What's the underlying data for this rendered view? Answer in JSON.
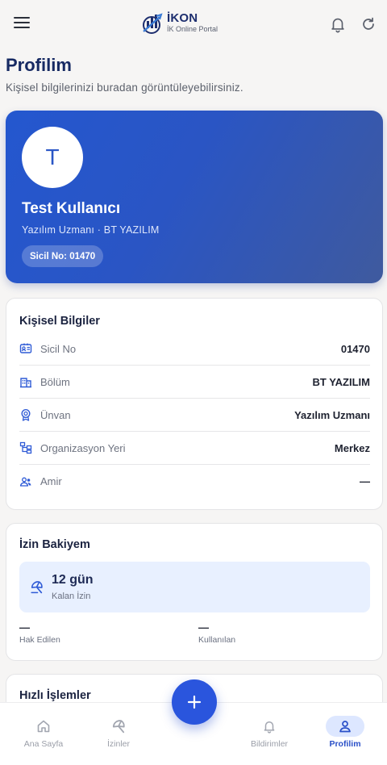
{
  "app": {
    "name": "İKON",
    "subtitle": "İK Online Portal"
  },
  "header": {
    "title": "Profilim",
    "subtitle": "Kişisel bilgilerinizi buradan görüntüleyebilirsiniz."
  },
  "profile": {
    "avatar_initial": "T",
    "name": "Test Kullanıcı",
    "role_line": "Yazılım Uzmanı · BT YAZILIM",
    "sicil_badge": "Sicil No: 01470"
  },
  "personal_info": {
    "title": "Kişisel Bilgiler",
    "rows": [
      {
        "label": "Sicil No",
        "value": "01470",
        "icon": "id-card-icon"
      },
      {
        "label": "Bölüm",
        "value": "BT YAZILIM",
        "icon": "building-icon"
      },
      {
        "label": "Ünvan",
        "value": "Yazılım Uzmanı",
        "icon": "award-icon"
      },
      {
        "label": "Organizasyon Yeri",
        "value": "Merkez",
        "icon": "org-chart-icon"
      },
      {
        "label": "Amir",
        "value": "—",
        "icon": "manager-icon"
      }
    ]
  },
  "leave_balance": {
    "title": "İzin Bakiyem",
    "remaining_days": "12 gün",
    "remaining_label": "Kalan İzin",
    "earned_value": "—",
    "earned_label": "Hak Edilen",
    "used_value": "—",
    "used_label": "Kullanılan"
  },
  "quick_actions": {
    "title": "Hızlı İşlemler"
  },
  "bottom_nav": [
    {
      "label": "Ana Sayfa",
      "icon": "home-icon",
      "active": false
    },
    {
      "label": "İzinler",
      "icon": "beach-umbrella-icon",
      "active": false
    },
    {
      "label": "Bildirimler",
      "icon": "bell-icon",
      "active": false
    },
    {
      "label": "Profilim",
      "icon": "person-icon",
      "active": true
    }
  ],
  "colors": {
    "brand_dark": "#172a63",
    "primary": "#2a55dd",
    "card_gradient_start": "#2457cf",
    "card_gradient_end": "#3f5a9e",
    "leave_box_bg": "#e8f0ff"
  }
}
